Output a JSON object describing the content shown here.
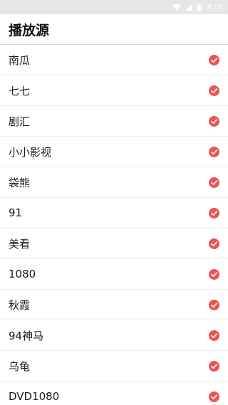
{
  "status_bar": {
    "time": "4:19",
    "icons": [
      "wifi-icon",
      "signal-icon",
      "battery-icon"
    ]
  },
  "app_bar": {
    "title": "播放源"
  },
  "sources": [
    {
      "label": "南瓜",
      "checked": true
    },
    {
      "label": "七七",
      "checked": true
    },
    {
      "label": "剧汇",
      "checked": true
    },
    {
      "label": "小小影视",
      "checked": true
    },
    {
      "label": "袋熊",
      "checked": true
    },
    {
      "label": "91",
      "checked": true
    },
    {
      "label": "美看",
      "checked": true
    },
    {
      "label": "1080",
      "checked": true
    },
    {
      "label": "秋霞",
      "checked": true
    },
    {
      "label": "94神马",
      "checked": true
    },
    {
      "label": "乌龟",
      "checked": true
    },
    {
      "label": "DVD1080",
      "checked": true
    }
  ],
  "colors": {
    "accent": "#ef5350",
    "status_bar_bg": "#e6e6e6"
  }
}
